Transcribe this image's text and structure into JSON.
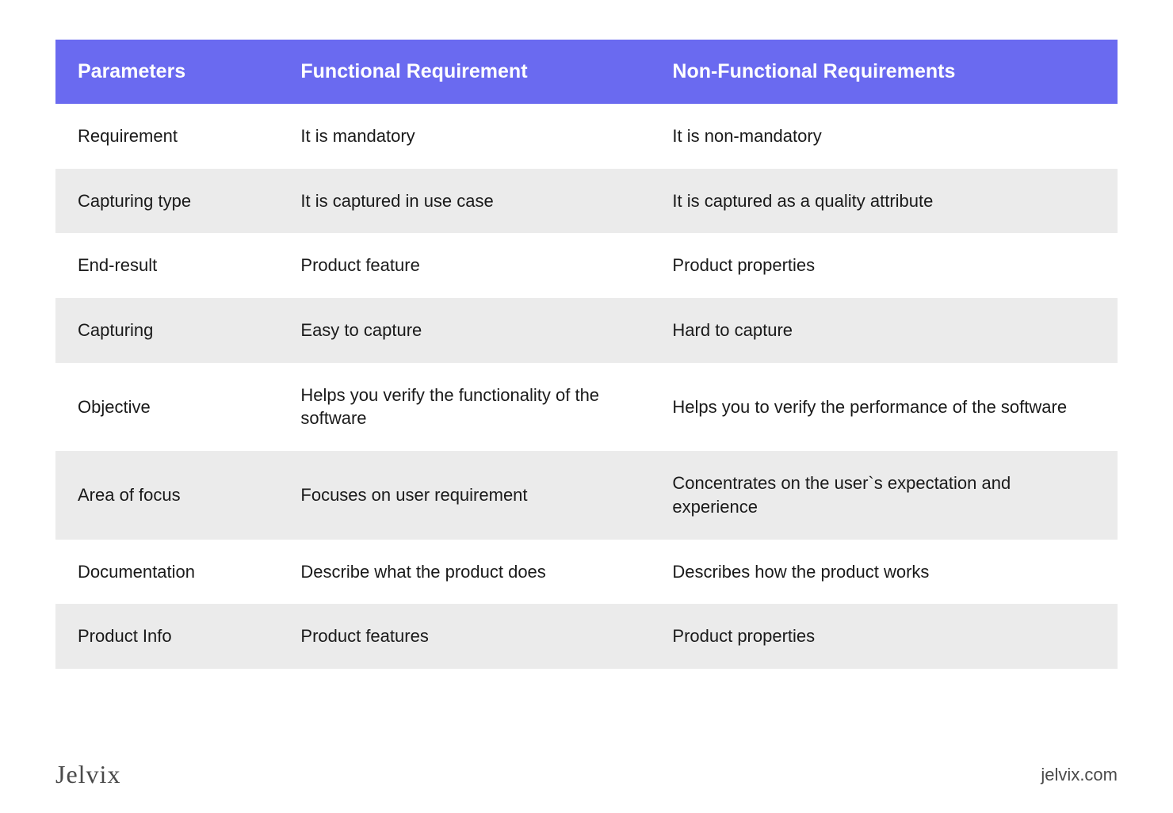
{
  "chart_data": {
    "type": "table",
    "columns": [
      "Parameters",
      "Functional Requirement",
      "Non-Functional Requirements"
    ],
    "rows": [
      [
        "Requirement",
        "It is mandatory",
        "It is non-mandatory"
      ],
      [
        "Capturing type",
        "It is captured in use case",
        "It is captured as a quality attribute"
      ],
      [
        "End-result",
        "Product feature",
        "Product properties"
      ],
      [
        "Capturing",
        "Easy to capture",
        "Hard to capture"
      ],
      [
        "Objective",
        "Helps you verify the functionality of the software",
        "Helps you to verify the performance of the software"
      ],
      [
        "Area of focus",
        "Focuses on user requirement",
        "Concentrates on the user`s expectation and experience"
      ],
      [
        "Documentation",
        "Describe what the product does",
        "Describes how the product works"
      ],
      [
        "Product Info",
        "Product features",
        "Product properties"
      ]
    ]
  },
  "footer": {
    "brand": "Jelvix",
    "site": "jelvix.com"
  }
}
